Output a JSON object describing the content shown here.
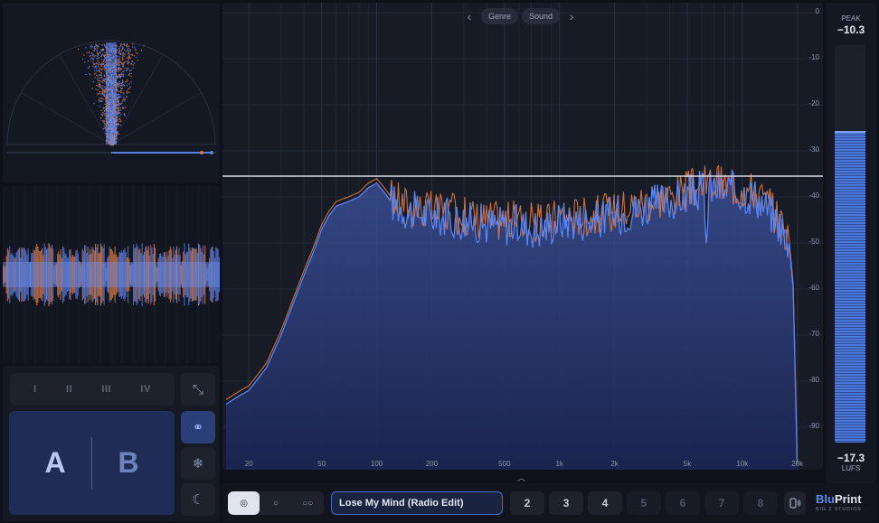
{
  "spectrum": {
    "nav": {
      "prev_icon": "chevron-left-icon",
      "genre_label": "Genre",
      "sound_label": "Sound",
      "next_icon": "chevron-right-icon"
    },
    "db_labels": [
      "0",
      "-10",
      "-20",
      "-30",
      "-40",
      "-50",
      "-60",
      "-70",
      "-80",
      "-90"
    ],
    "freq_labels": [
      "20",
      "50",
      "100",
      "200",
      "500",
      "1k",
      "2k",
      "5k",
      "10k",
      "20k"
    ],
    "reference_line_db": -35.5,
    "colors": {
      "spectrum_fill": "#2b3b75",
      "spectrum_line_a": "#5b84f0",
      "spectrum_line_b": "#e27a3a",
      "reference_line": "#d9dde6"
    }
  },
  "meter": {
    "peak_label": "PEAK",
    "peak_value": "−10.3",
    "lufs_value": "−17.3",
    "lufs_label": "LUFS",
    "fill_level": 0.78,
    "marker_level": 0.78
  },
  "left": {
    "stereo_icon": "stereo-field-scope",
    "waveform_icon": "waveform-history",
    "sections": [
      "I",
      "II",
      "III",
      "IV"
    ],
    "ab": {
      "a_label": "A",
      "b_label": "B"
    },
    "side_buttons": [
      {
        "name": "collapse-button",
        "icon": "collapse-arrows-icon",
        "glyph": "⤡",
        "active": false
      },
      {
        "name": "link-button",
        "icon": "link-icon",
        "glyph": "⚭",
        "active": true
      },
      {
        "name": "freeze-button",
        "icon": "snowflake-icon",
        "glyph": "❄",
        "active": false
      },
      {
        "name": "dark-mode-button",
        "icon": "moon-icon",
        "glyph": "☾",
        "active": false
      }
    ]
  },
  "bottom": {
    "modes": [
      {
        "name": "mode-stereo",
        "glyph": "◎",
        "active": true
      },
      {
        "name": "mode-mono",
        "glyph": "○",
        "active": false
      },
      {
        "name": "mode-dual",
        "glyph": "○○",
        "active": false
      }
    ],
    "track_name": "Lose My Mind (Radio Edit)",
    "slots": [
      "2",
      "3",
      "4",
      "5",
      "6",
      "7",
      "8"
    ],
    "slots_enabled": [
      true,
      true,
      true,
      false,
      false,
      false,
      false
    ],
    "device_icon": "speaker-icon",
    "brand_blu": "Blu",
    "brand_print": "Print",
    "brand_sub": "BIG Z STUDIOS"
  }
}
